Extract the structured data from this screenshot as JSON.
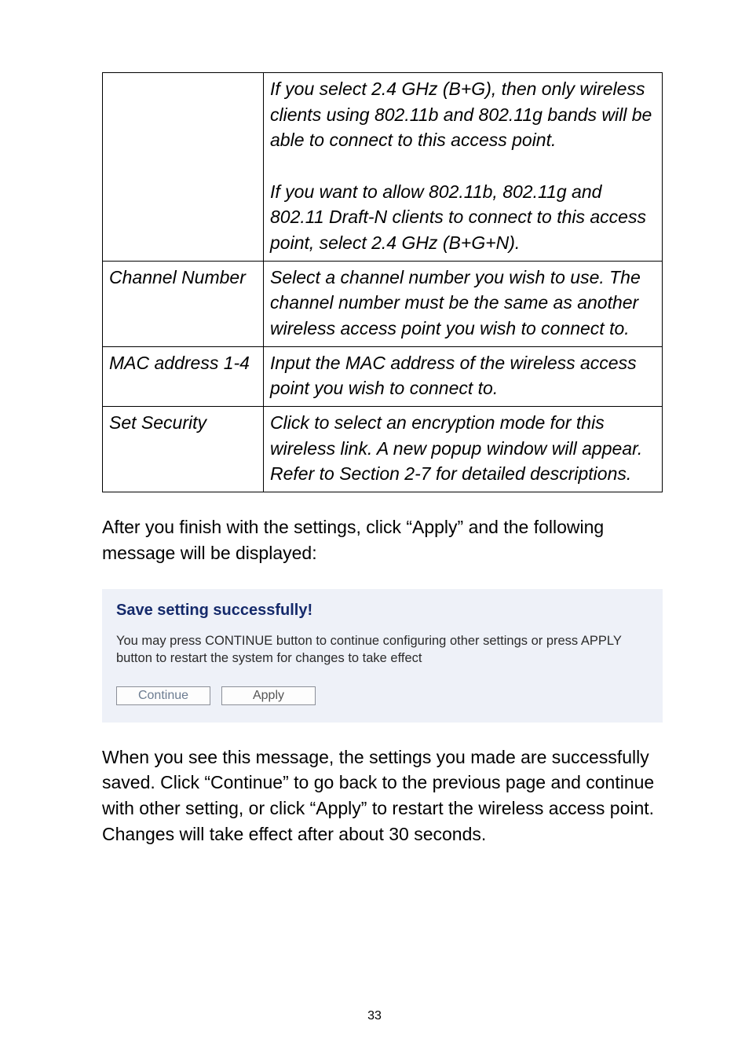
{
  "table": {
    "rows": [
      {
        "label": "",
        "text": "If you select 2.4 GHz (B+G), then only wireless clients using 802.11b and 802.11g bands will be able to connect to this access point.<br><br>If you want to allow 802.11b, 802.11g and 802.11 Draft-N clients to connect to this access point, select 2.4 GHz (B+G+N)."
      },
      {
        "label": "Channel Number",
        "text": "Select a channel number you wish to use. The channel number must be the same as another wireless access point you wish to connect to."
      },
      {
        "label": "MAC address 1-4",
        "text": "Input the MAC address of the wireless access point you wish to connect to."
      },
      {
        "label": "Set Security",
        "text": "Click to select an encryption mode for this wireless link. A new popup window will appear. Refer to Section 2-7 for detailed descriptions."
      }
    ]
  },
  "paragraph1": "After you finish with the settings, click “Apply” and the following message will be displayed:",
  "saveBox": {
    "title": "Save setting successfully!",
    "text": "You may press CONTINUE button to continue configuring other settings or press APPLY button to restart the system for changes to take effect",
    "continueLabel": "Continue",
    "applyLabel": "Apply"
  },
  "paragraph2": "When you see this message, the settings you made are successfully saved. Click “Continue” to go back to the previous page and continue with other setting, or click “Apply” to restart the wireless access point. Changes will take effect after about 30 seconds.",
  "pageNumber": "33"
}
